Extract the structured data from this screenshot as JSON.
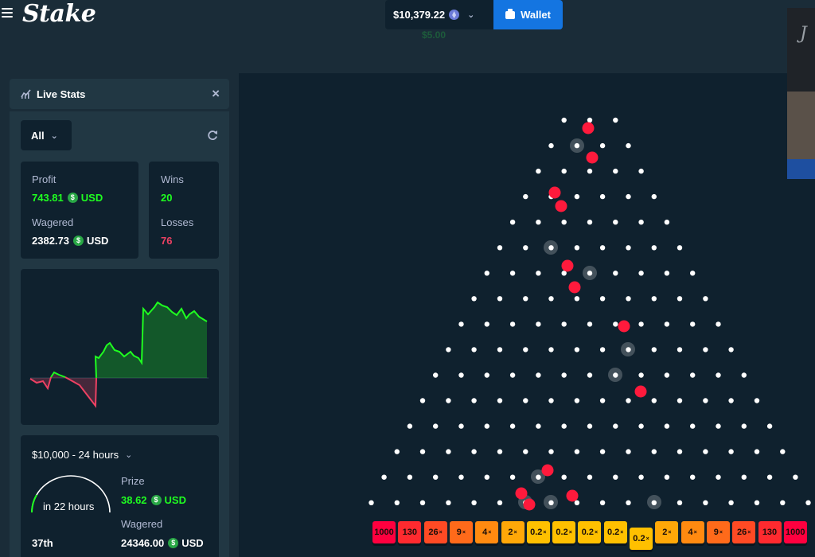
{
  "header": {
    "logo": "Stake",
    "balance": "$10,379.22",
    "sub_balance": "$5.00",
    "wallet_label": "Wallet"
  },
  "live_stats": {
    "title": "Live Stats",
    "filter": "All",
    "profit_label": "Profit",
    "profit_value": "743.81",
    "profit_unit": "USD",
    "wagered_label": "Wagered",
    "wagered_value": "2382.73",
    "wagered_unit": "USD",
    "wins_label": "Wins",
    "wins_value": "20",
    "losses_label": "Losses",
    "losses_value": "76"
  },
  "race": {
    "title": "$10,000 - 24 hours",
    "time_left": "in 22 hours",
    "position": "37th",
    "prize_label": "Prize",
    "prize_value": "38.62",
    "prize_unit": "USD",
    "wagered_label": "Wagered",
    "wagered_value": "24346.00",
    "wagered_unit": "USD"
  },
  "plinko": {
    "rows": 16,
    "multipliers": [
      "1000",
      "130",
      "26×",
      "9×",
      "4×",
      "2×",
      "0.2×",
      "0.2×",
      "0.2×",
      "0.2×",
      "0.2×",
      "2×",
      "4×",
      "9×",
      "26×",
      "130",
      "1000"
    ],
    "multiplier_colors": [
      "#ff003f",
      "#ff2a2f",
      "#ff4a24",
      "#ff6a1a",
      "#ff8a10",
      "#ffa808",
      "#ffc000",
      "#ffc000",
      "#ffc000",
      "#ffc000",
      "#ffc000",
      "#ffa808",
      "#ff8a10",
      "#ff6a1a",
      "#ff4a24",
      "#ff2a2f",
      "#ff003f"
    ]
  },
  "colors": {
    "accent_blue": "#1475e1",
    "win_green": "#1fff20",
    "loss_red": "#ed4163",
    "background": "#0f212e",
    "panel": "#213743"
  }
}
